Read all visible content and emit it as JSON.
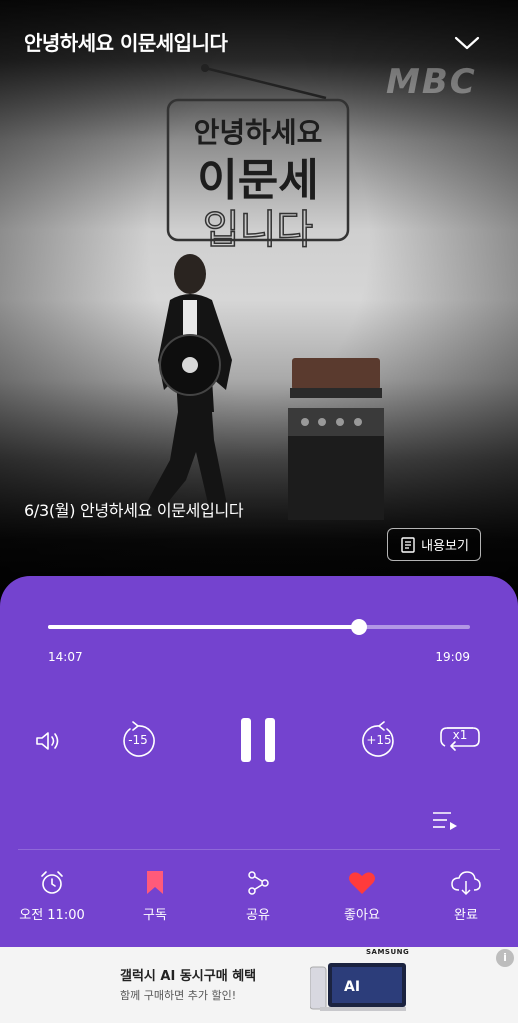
{
  "header": {
    "title": "안녕하세요 이문세입니다",
    "collapse_icon": "chevron-down-icon",
    "channel_logo": "MBC"
  },
  "poster": {
    "line1": "안녕하세요",
    "line2": "이문세",
    "line3": "입니다"
  },
  "episode": {
    "title": "6/3(월) 안녕하세요 이문세입니다",
    "details_label": "내용보기"
  },
  "player": {
    "elapsed": "14:07",
    "total": "19:09",
    "progress": 0.737,
    "rewind_label": "-15",
    "forward_label": "+15",
    "speed_label": "x1"
  },
  "actions": [
    {
      "label": "오전 11:00",
      "icon": "alarm-clock-icon"
    },
    {
      "label": "구독",
      "icon": "bookmark-icon"
    },
    {
      "label": "공유",
      "icon": "share-icon"
    },
    {
      "label": "좋아요",
      "icon": "heart-icon"
    },
    {
      "label": "완료",
      "icon": "cloud-download-icon"
    }
  ],
  "ad": {
    "brand": "SAMSUNG",
    "title": "갤럭시 AI 동시구매 혜택",
    "subtitle": "함께 구매하면 추가 할인!",
    "info": "i",
    "product_text": "AI"
  },
  "colors": {
    "player_bg": "#7443cf",
    "bookmark": "#ff5a7a",
    "heart": "#ff3b3b"
  }
}
